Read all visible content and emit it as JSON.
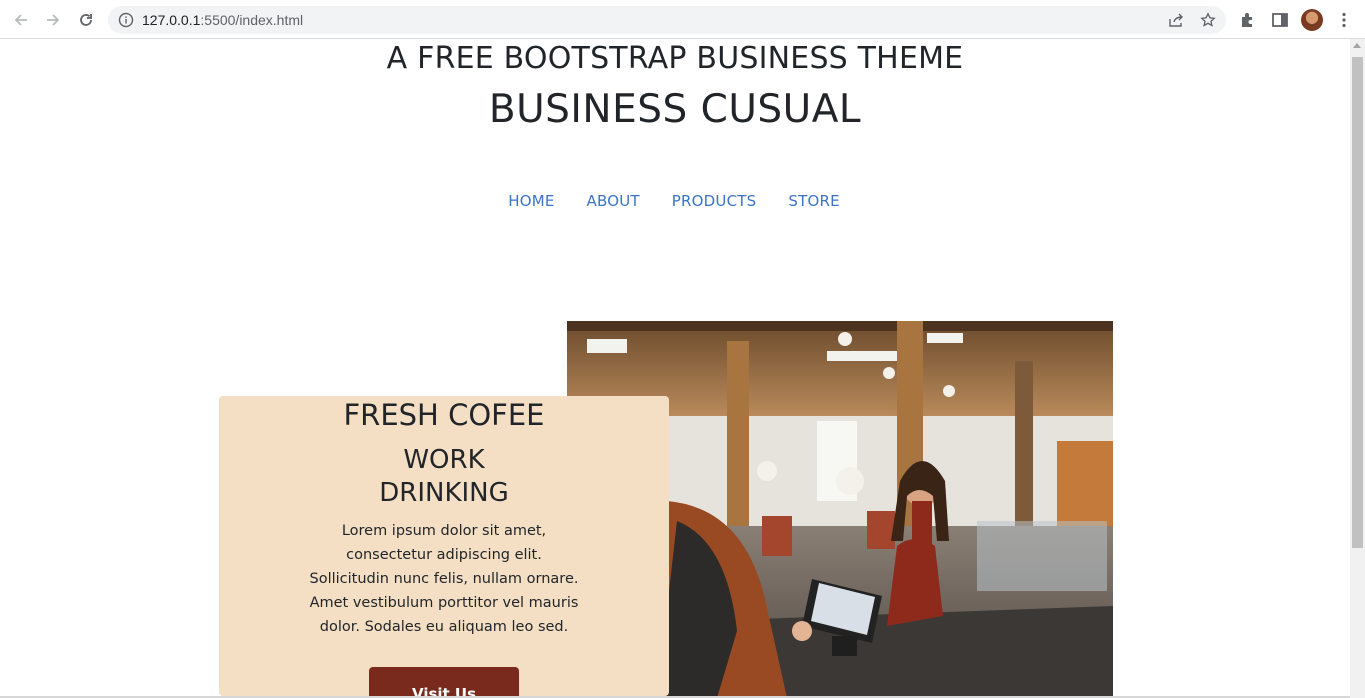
{
  "browser": {
    "url_host": "127.0.0.1",
    "url_path": ":5500/index.html",
    "icons": {
      "back": "back-arrow-icon",
      "forward": "forward-arrow-icon",
      "reload": "reload-icon",
      "site_info": "info-icon",
      "share": "share-icon",
      "bookmark": "star-icon",
      "extensions": "puzzle-icon",
      "side_panel": "side-panel-icon",
      "menu": "kebab-menu-icon"
    }
  },
  "header": {
    "upper": "A FREE BOOTSTRAP BUSINESS THEME",
    "lower": "BUSINESS CUSUAL"
  },
  "nav": {
    "items": [
      "HOME",
      "ABOUT",
      "PRODUCTS",
      "STORE"
    ]
  },
  "intro": {
    "heading_upper": "FRESH COFEE",
    "heading_lower_1": "WORK",
    "heading_lower_2": "DRINKING",
    "body_lines": [
      "Lorem ipsum dolor sit amet,",
      "consectetur adipiscing elit.",
      "Sollicitudin nunc felis, nullam ornare.",
      "Amet vestibulum porttitor vel mauris",
      "dolor. Sodales eu aliquam leo sed."
    ],
    "button_label": "Visit Us"
  },
  "colors": {
    "nav_link": "#3b73c8",
    "card_bg": "#f5dfc4",
    "button_bg": "#7a2a1d",
    "text": "#212529"
  }
}
